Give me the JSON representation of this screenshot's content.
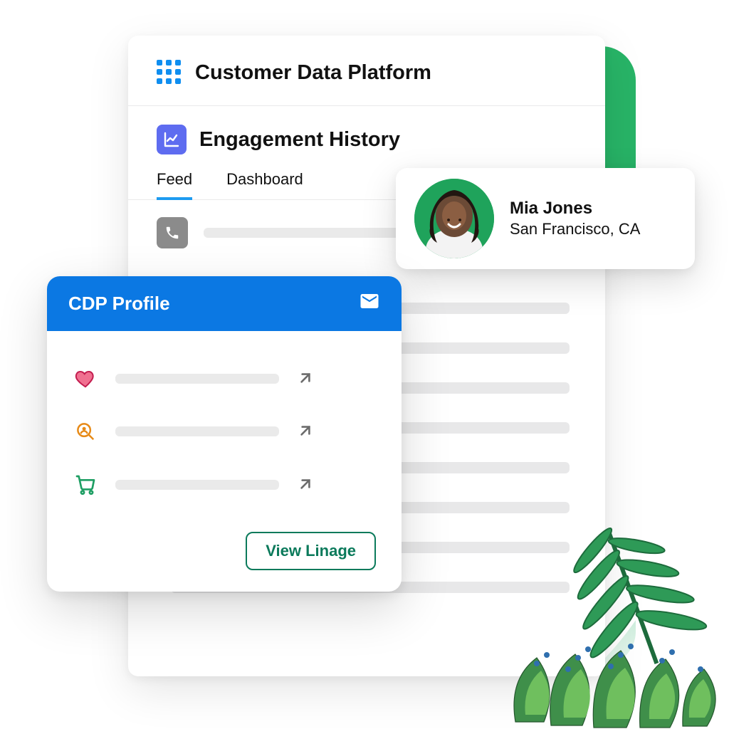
{
  "colors": {
    "primary_blue": "#0b78e3",
    "tab_active": "#1d9bf0",
    "badge_purple": "#5e6cf0",
    "green": "#28B467",
    "outline_green": "#0b7a5b"
  },
  "header": {
    "title": "Customer Data Platform"
  },
  "section": {
    "title": "Engagement History",
    "tabs": [
      "Feed",
      "Dashboard"
    ],
    "active_tab_index": 0
  },
  "contact": {
    "name": "Mia Jones",
    "location": "San Francisco, CA"
  },
  "cdp": {
    "title": "CDP Profile",
    "header_icon": "mail-icon",
    "rows": [
      {
        "icon": "heart-icon"
      },
      {
        "icon": "search-user-icon"
      },
      {
        "icon": "cart-icon"
      }
    ],
    "button_label": "View Linage"
  }
}
